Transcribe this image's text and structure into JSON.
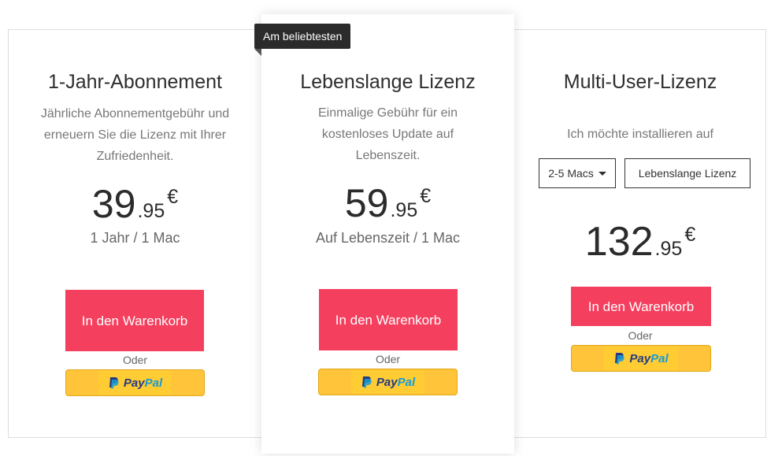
{
  "plans": {
    "annual": {
      "title": "1-Jahr-Abonnement",
      "description": "Jährliche Abonnementgebühr und erneuern Sie die Lizenz mit Ihrer Zufriedenheit.",
      "price_int": "39",
      "price_cents": ".95",
      "currency": "€",
      "term": "1 Jahr / 1 Mac",
      "cart_label": "In den Warenkorb",
      "or_label": "Oder",
      "paypal_pay": "Pay",
      "paypal_pal": "Pal"
    },
    "lifetime": {
      "badge": "Am beliebtesten",
      "title": "Lebenslange Lizenz",
      "description": "Einmalige Gebühr für ein kostenloses Update auf Lebenszeit.",
      "price_int": "59",
      "price_cents": ".95",
      "currency": "€",
      "term": "Auf Lebenszeit / 1 Mac",
      "cart_label": "In den Warenkorb",
      "or_label": "Oder",
      "paypal_pay": "Pay",
      "paypal_pal": "Pal"
    },
    "multi_user": {
      "title": "Multi-User-Lizenz",
      "install_label": "Ich möchte installieren auf",
      "mac_select_value": "2-5 Macs",
      "license_select_value": "Lebenslange Lizenz",
      "price_int": "132",
      "price_cents": ".95",
      "currency": "€",
      "cart_label": "In den Warenkorb",
      "or_label": "Oder",
      "paypal_pay": "Pay",
      "paypal_pal": "Pal"
    }
  },
  "colors": {
    "cart_button": "#f43f5e",
    "paypal_button": "#ffc439",
    "badge": "#2b2b2b"
  },
  "icons": {
    "paypal": "paypal-logo-icon",
    "select_caret": "caret-down-icon"
  }
}
